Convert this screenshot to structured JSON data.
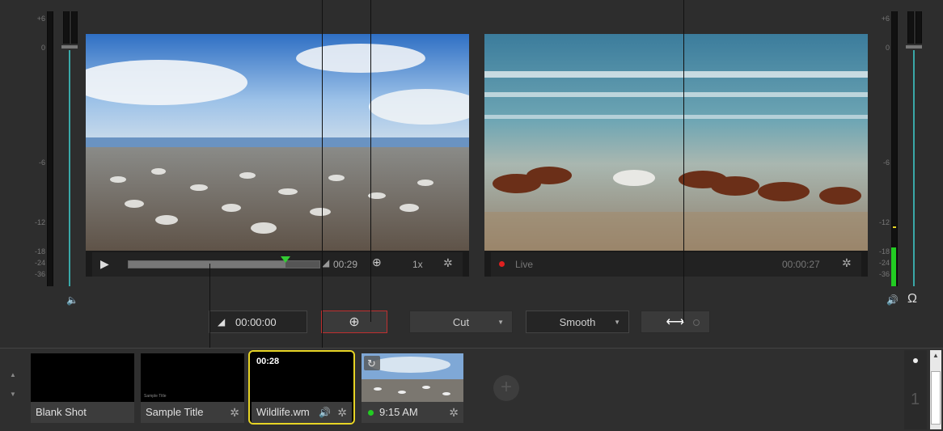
{
  "meter_scale_left": [
    "+6",
    "0",
    "-6",
    "-12",
    "-18",
    "-24",
    "-36"
  ],
  "meter_scale_right": [
    "+6",
    "0",
    "-6",
    "-12",
    "-18",
    "-24",
    "-36"
  ],
  "preview": {
    "timecode": "00:29",
    "zoom": "1x",
    "play_icon": "play-icon",
    "position_fraction": 0.82
  },
  "live": {
    "status": "Live",
    "timecode": "00:00:27"
  },
  "transition_bar": {
    "duration_value": "00:00:00",
    "cut_label": "Cut",
    "smooth_label": "Smooth"
  },
  "shots": [
    {
      "label": "Blank Shot"
    },
    {
      "label": "Sample Title",
      "thumb_text": "Sample Title"
    },
    {
      "label": "Wildlife.wm",
      "duration": "00:28",
      "selected": true
    },
    {
      "label": "9:15 AM"
    }
  ],
  "layer_number": "1",
  "colors": {
    "accent_teal": "#3aa8a8",
    "selected_border": "#e6d325",
    "live_dot": "#e02020",
    "add_button_border": "#c03030",
    "status_green": "#22cc22"
  }
}
